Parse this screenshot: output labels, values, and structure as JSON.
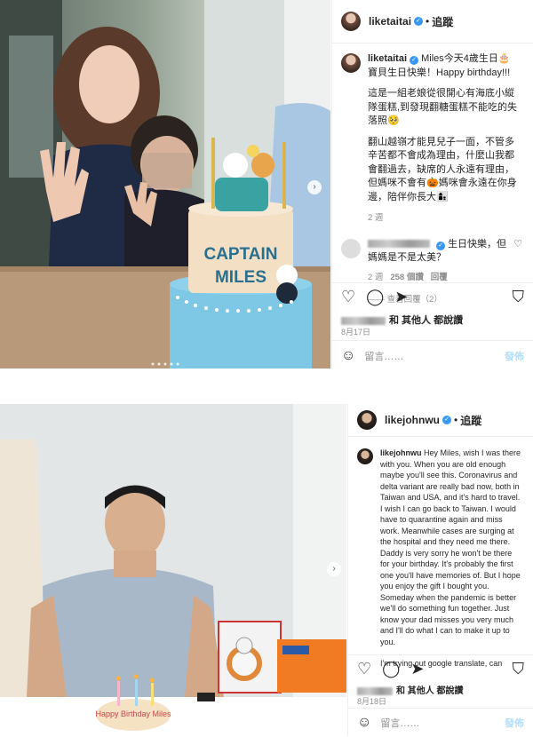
{
  "post1": {
    "username": "liketaitai",
    "follow_label": "追蹤",
    "caption_main": "Miles今天4歲生日🎂 寶貝生日快樂！Happy birthday!!!",
    "caption_p2": "這是一組老娘從很開心有海底小縱隊蛋糕,到發現翻糖蛋糕不能吃的失落照🥺",
    "caption_p3": "翻山越嶺才能見兒子一面，不管多辛苦都不會成為理由，什麼山我都會翻過去，缺席的人永遠有理由，但媽咪不會有🎃媽咪會永遠在你身邊，陪伴你長大👩‍👦",
    "caption_time": "2 週",
    "comment_text": "生日快樂，但媽媽是不是太美？",
    "comment_time": "2 週",
    "comment_likes": "258 個讚",
    "comment_reply": "回覆",
    "view_replies": "查看回覆（2）",
    "likes_text": "和 其他人 都說讚",
    "date": "8月17日",
    "comment_placeholder": "留言……",
    "post_label": "發佈",
    "cake_text_1": "CAPTAIN",
    "cake_text_2": "MILES"
  },
  "post2": {
    "username": "likejohnwu",
    "follow_label": "追蹤",
    "caption": "Hey Miles, wish I was there with you. When you are old enough maybe you'll see this. Coronavirus and delta variant are really bad now, both in Taiwan and USA, and it's hard to travel. I wish I can go back to Taiwan. I would have to quarantine again and miss work. Meanwhile cases are surging at the hospital and they need me there. Daddy is very sorry he won't be there for your birthday. It's probably the first one you'll have memories of. But I hope you enjoy the gift I bought you. Someday when the pandemic is better we'll do something fun together. Just know your dad misses you very much and I'll do what I can to make it up to you.",
    "caption_tail": "I'm trying out google translate, can",
    "likes_text": "和 其他人 都說讚",
    "date": "8月18日",
    "comment_placeholder": "留言……",
    "post_label": "發佈",
    "cake_text": "Happy Birthday Miles"
  }
}
